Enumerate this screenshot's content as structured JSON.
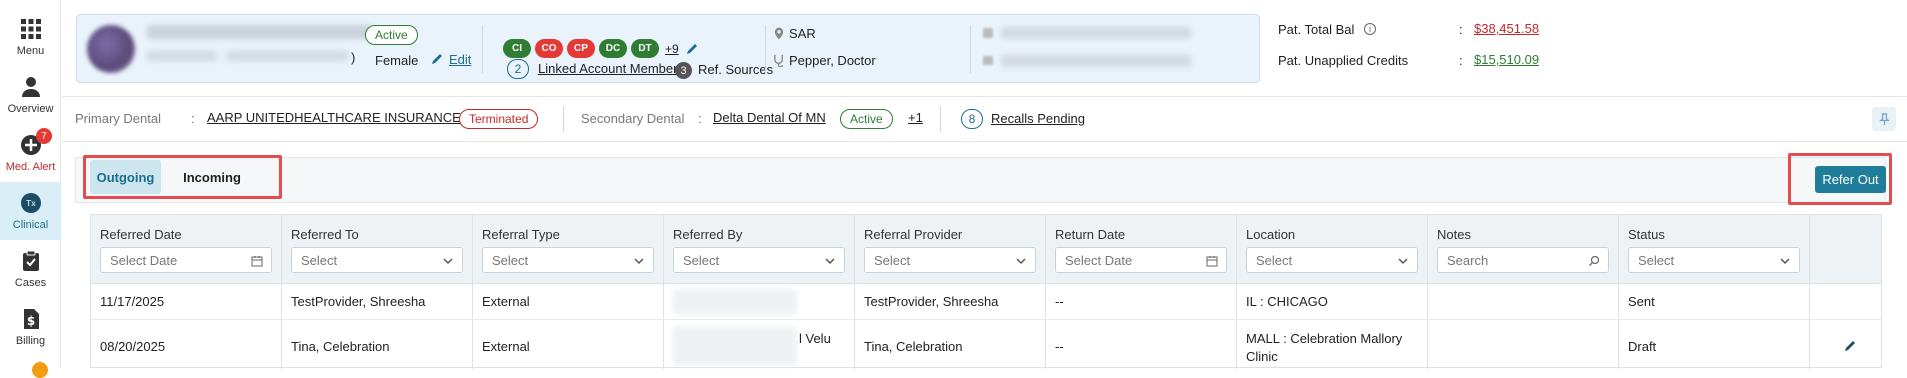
{
  "sidebar": {
    "items": [
      {
        "label": "Menu",
        "icon": "grid-icon"
      },
      {
        "label": "Overview",
        "icon": "person-icon"
      },
      {
        "label": "Med. Alert",
        "icon": "plus-circle-icon",
        "badge": "7"
      },
      {
        "label": "Clinical",
        "icon": "tx-icon"
      },
      {
        "label": "Cases",
        "icon": "clipboard-icon"
      },
      {
        "label": "Billing",
        "icon": "dollar-icon"
      }
    ]
  },
  "patient": {
    "status": "Active",
    "gender": "Female",
    "edit_label": "Edit",
    "tags": [
      "CI",
      "CO",
      "CP",
      "DC",
      "DT"
    ],
    "tags_more": "+9",
    "linked_count": "2",
    "linked_label": "Linked Account Members",
    "ref_count": "3",
    "ref_label": "Ref. Sources",
    "location": "SAR",
    "provider": "Pepper, Doctor"
  },
  "balances": {
    "total_label": "Pat. Total Bal",
    "total_value": "$38,451.58",
    "unapplied_label": "Pat. Unapplied Credits",
    "unapplied_value": "$15,510.09",
    "sep": ":"
  },
  "insurance": {
    "primary_label": "Primary Dental",
    "primary_name": "AARP UNITEDHEALTHCARE INSURANCE",
    "primary_status": "Terminated",
    "secondary_label": "Secondary Dental",
    "secondary_name": "Delta Dental Of MN",
    "secondary_status": "Active",
    "secondary_more": "+1",
    "recalls_count": "8",
    "recalls_label": "Recalls Pending",
    "sep": ":"
  },
  "tabs": {
    "outgoing": "Outgoing",
    "incoming": "Incoming"
  },
  "refer_out_label": "Refer Out",
  "grid": {
    "columns": [
      {
        "title": "Referred Date",
        "filter": "Select Date",
        "kind": "date"
      },
      {
        "title": "Referred To",
        "filter": "Select",
        "kind": "select"
      },
      {
        "title": "Referral Type",
        "filter": "Select",
        "kind": "select"
      },
      {
        "title": "Referred By",
        "filter": "Select",
        "kind": "select"
      },
      {
        "title": "Referral Provider",
        "filter": "Select",
        "kind": "select"
      },
      {
        "title": "Return Date",
        "filter": "Select Date",
        "kind": "date"
      },
      {
        "title": "Location",
        "filter": "Select",
        "kind": "select"
      },
      {
        "title": "Notes",
        "filter": "Search",
        "kind": "search"
      },
      {
        "title": "Status",
        "filter": "Select",
        "kind": "select"
      }
    ],
    "rows": [
      {
        "referred_date": "11/17/2025",
        "referred_to": "TestProvider, Shreesha",
        "referral_type": "External",
        "referred_by": "",
        "referral_provider": "TestProvider, Shreesha",
        "return_date": "--",
        "location": "IL : CHICAGO",
        "notes": "",
        "status": "Sent"
      },
      {
        "referred_date": "08/20/2025",
        "referred_to": "Tina, Celebration",
        "referral_type": "External",
        "referred_by": "l Velu",
        "referral_provider": "Tina, Celebration",
        "return_date": "--",
        "location": "MALL : Celebration Mallory Clinic",
        "notes": "",
        "status": "Draft"
      }
    ]
  }
}
